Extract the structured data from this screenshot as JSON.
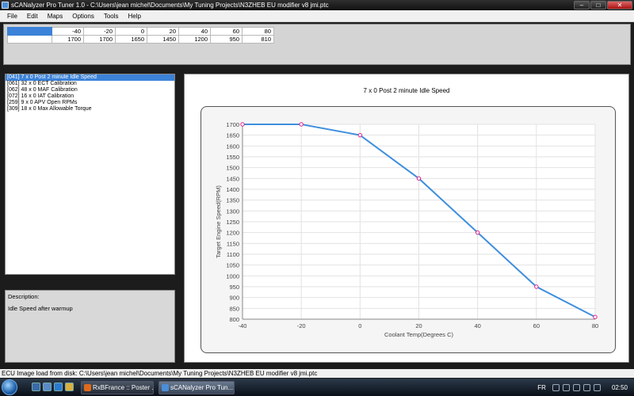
{
  "window": {
    "title": "sCANalyzer Pro Tuner 1.0 - C:\\Users\\jean michel\\Documents\\My Tuning Projects\\N3ZHEB EU modifier v8 jmi.ptc",
    "controls": {
      "minimize": "–",
      "maximize": "□",
      "close": "✕"
    }
  },
  "menu": [
    "File",
    "Edit",
    "Maps",
    "Options",
    "Tools",
    "Help"
  ],
  "table": {
    "header": [
      "-40",
      "-20",
      "0",
      "20",
      "40",
      "60",
      "80"
    ],
    "values": [
      "1700",
      "1700",
      "1650",
      "1450",
      "1200",
      "950",
      "810"
    ]
  },
  "maps_list": [
    "[041]  7 x 0 Post 2 minute Idle Speed",
    "[061]  32 x 0 ECT Calibration",
    "[062]  48 x 0 MAF Calibration",
    "[072]  16 x 0 IAT Calibration",
    "[259]  9 x 0 APV Open RPMs",
    "[309]  18 x 0 Max Allowable Torque"
  ],
  "description": {
    "label": "Description:",
    "text": "Idle Speed after warmup"
  },
  "chart_data": {
    "type": "line",
    "title": "7 x 0 Post 2 minute Idle Speed",
    "xlabel": "Coolant Temp(Degrees C)",
    "ylabel": "Target Engine Speed(RPM)",
    "x": [
      -40,
      -20,
      0,
      20,
      40,
      60,
      80
    ],
    "series": [
      {
        "values": [
          1700,
          1700,
          1650,
          1450,
          1200,
          950,
          810
        ]
      }
    ],
    "xlim": [
      -40,
      80
    ],
    "ylim": [
      800,
      1700
    ],
    "xticks": [
      -40,
      -20,
      0,
      20,
      40,
      60,
      80
    ],
    "yticks": [
      800,
      850,
      900,
      950,
      1000,
      1050,
      1100,
      1150,
      1200,
      1250,
      1300,
      1350,
      1400,
      1450,
      1500,
      1550,
      1600,
      1650,
      1700
    ],
    "grid": true,
    "line_color": "#3f8fdd",
    "marker_color": "#e0208c"
  },
  "status": "ECU Image load from disk: C:\\Users\\jean michel\\Documents\\My Tuning Projects\\N3ZHEB EU modifier v8 jmi.ptc",
  "taskbar": {
    "tasks": [
      "RxBFrance :: Poster ...",
      "sCANalyzer Pro Tun..."
    ],
    "language": "FR",
    "time": "02:50"
  }
}
